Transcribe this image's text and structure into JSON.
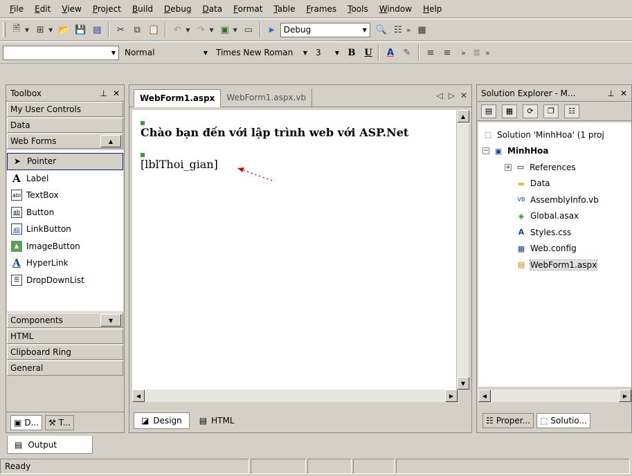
{
  "menu": [
    "File",
    "Edit",
    "View",
    "Project",
    "Build",
    "Debug",
    "Data",
    "Format",
    "Table",
    "Frames",
    "Tools",
    "Window",
    "Help"
  ],
  "toolbar": {
    "config_value": "Debug",
    "style_value": "",
    "block_format": "Normal",
    "font_name": "Times New Roman",
    "font_size": "3",
    "bold": "B",
    "underline": "U"
  },
  "toolbox": {
    "title": "Toolbox",
    "categories_top": [
      "My User Controls",
      "Data",
      "Web Forms"
    ],
    "items": [
      {
        "label": "Pointer",
        "icon": "pointer-arrow"
      },
      {
        "label": "Label",
        "icon": "A"
      },
      {
        "label": "TextBox",
        "icon": "abl"
      },
      {
        "label": "Button",
        "icon": "ab"
      },
      {
        "label": "LinkButton",
        "icon": "ab-link"
      },
      {
        "label": "ImageButton",
        "icon": "image"
      },
      {
        "label": "HyperLink",
        "icon": "A-link"
      },
      {
        "label": "DropDownList",
        "icon": "list"
      }
    ],
    "categories_bottom": [
      "Components",
      "HTML",
      "Clipboard Ring",
      "General"
    ],
    "tabs": [
      "D...",
      "T..."
    ]
  },
  "document": {
    "tabs": [
      "WebForm1.aspx",
      "WebForm1.aspx.vb"
    ],
    "heading": "Chào bạn đến với lập trình web với ASP.Net",
    "label_control": "[lblThoi_gian]",
    "view_tabs": [
      "Design",
      "HTML"
    ]
  },
  "solution_explorer": {
    "title": "Solution Explorer - M...",
    "tree": [
      {
        "label": "Solution 'MinhHoa' (1 proj",
        "icon": "solution",
        "indent": 0,
        "bold": false
      },
      {
        "label": "MinhHoa",
        "icon": "project",
        "indent": 1,
        "bold": true
      },
      {
        "label": "References",
        "icon": "references",
        "indent": 2,
        "bold": false
      },
      {
        "label": "Data",
        "icon": "folder",
        "indent": 2,
        "bold": false
      },
      {
        "label": "AssemblyInfo.vb",
        "icon": "vb-file",
        "indent": 2,
        "bold": false
      },
      {
        "label": "Global.asax",
        "icon": "asax-file",
        "indent": 2,
        "bold": false
      },
      {
        "label": "Styles.css",
        "icon": "css-file",
        "indent": 2,
        "bold": false
      },
      {
        "label": "Web.config",
        "icon": "config-file",
        "indent": 2,
        "bold": false
      },
      {
        "label": "WebForm1.aspx",
        "icon": "aspx-file",
        "indent": 2,
        "bold": false
      }
    ],
    "tabs": [
      "Proper...",
      "Solutio..."
    ]
  },
  "output": {
    "label": "Output"
  },
  "status": {
    "text": "Ready"
  }
}
